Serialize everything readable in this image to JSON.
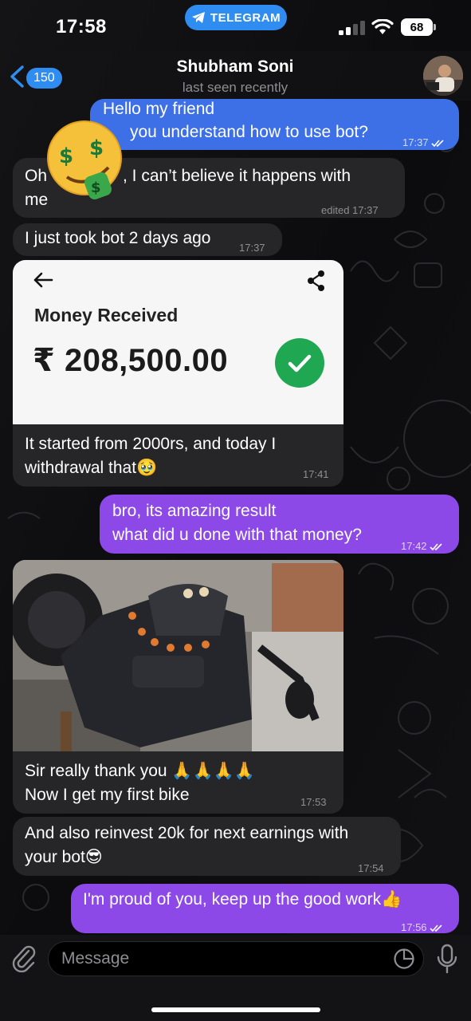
{
  "status_bar": {
    "time": "17:58",
    "app_pill": "TELEGRAM",
    "battery": "68"
  },
  "header": {
    "back_badge": "150",
    "title": "Shubham Soni",
    "subtitle": "last seen recently",
    "accent": "#2f8cf1"
  },
  "messages": {
    "m1": {
      "line1": "Hello my friend",
      "line2": "you understand how to use bot?",
      "time": "17:37"
    },
    "m2": {
      "line1a": "Oh",
      "line1b": ", I can’t believe it happens with",
      "line2": "me",
      "time": "edited 17:37"
    },
    "m3": {
      "text": "I just took bot 2 days ago",
      "time": "17:37"
    },
    "m4": {
      "card_title": "Money Received",
      "card_amount": "₹ 208,500.00",
      "line1": "It started from 2000rs, and today I",
      "line2": "withdrawal that🥹",
      "time": "17:41"
    },
    "m5": {
      "line1": "bro, its amazing result",
      "line2": "what did u done with that money?",
      "time": "17:42"
    },
    "m6": {
      "line1": "Sir really thank you 🙏🙏🙏🙏",
      "line2": "Now I get my first bike",
      "time": "17:53"
    },
    "m7": {
      "line1": "And also reinvest 20k for next earnings with",
      "line2": "your bot😎",
      "time": "17:54"
    },
    "m8": {
      "text": "I'm proud of you, keep up the good work👍",
      "time": "17:56"
    }
  },
  "input": {
    "placeholder": "Message"
  },
  "colors": {
    "incoming": "#262628",
    "outgoing": "#8c49e8",
    "success": "#1fa752"
  },
  "icons": [
    "back-chevron-icon",
    "paperclip-icon",
    "sticker-icon",
    "microphone-icon",
    "share-icon",
    "arrow-left-icon",
    "checkmark-icon",
    "double-check-icon"
  ]
}
